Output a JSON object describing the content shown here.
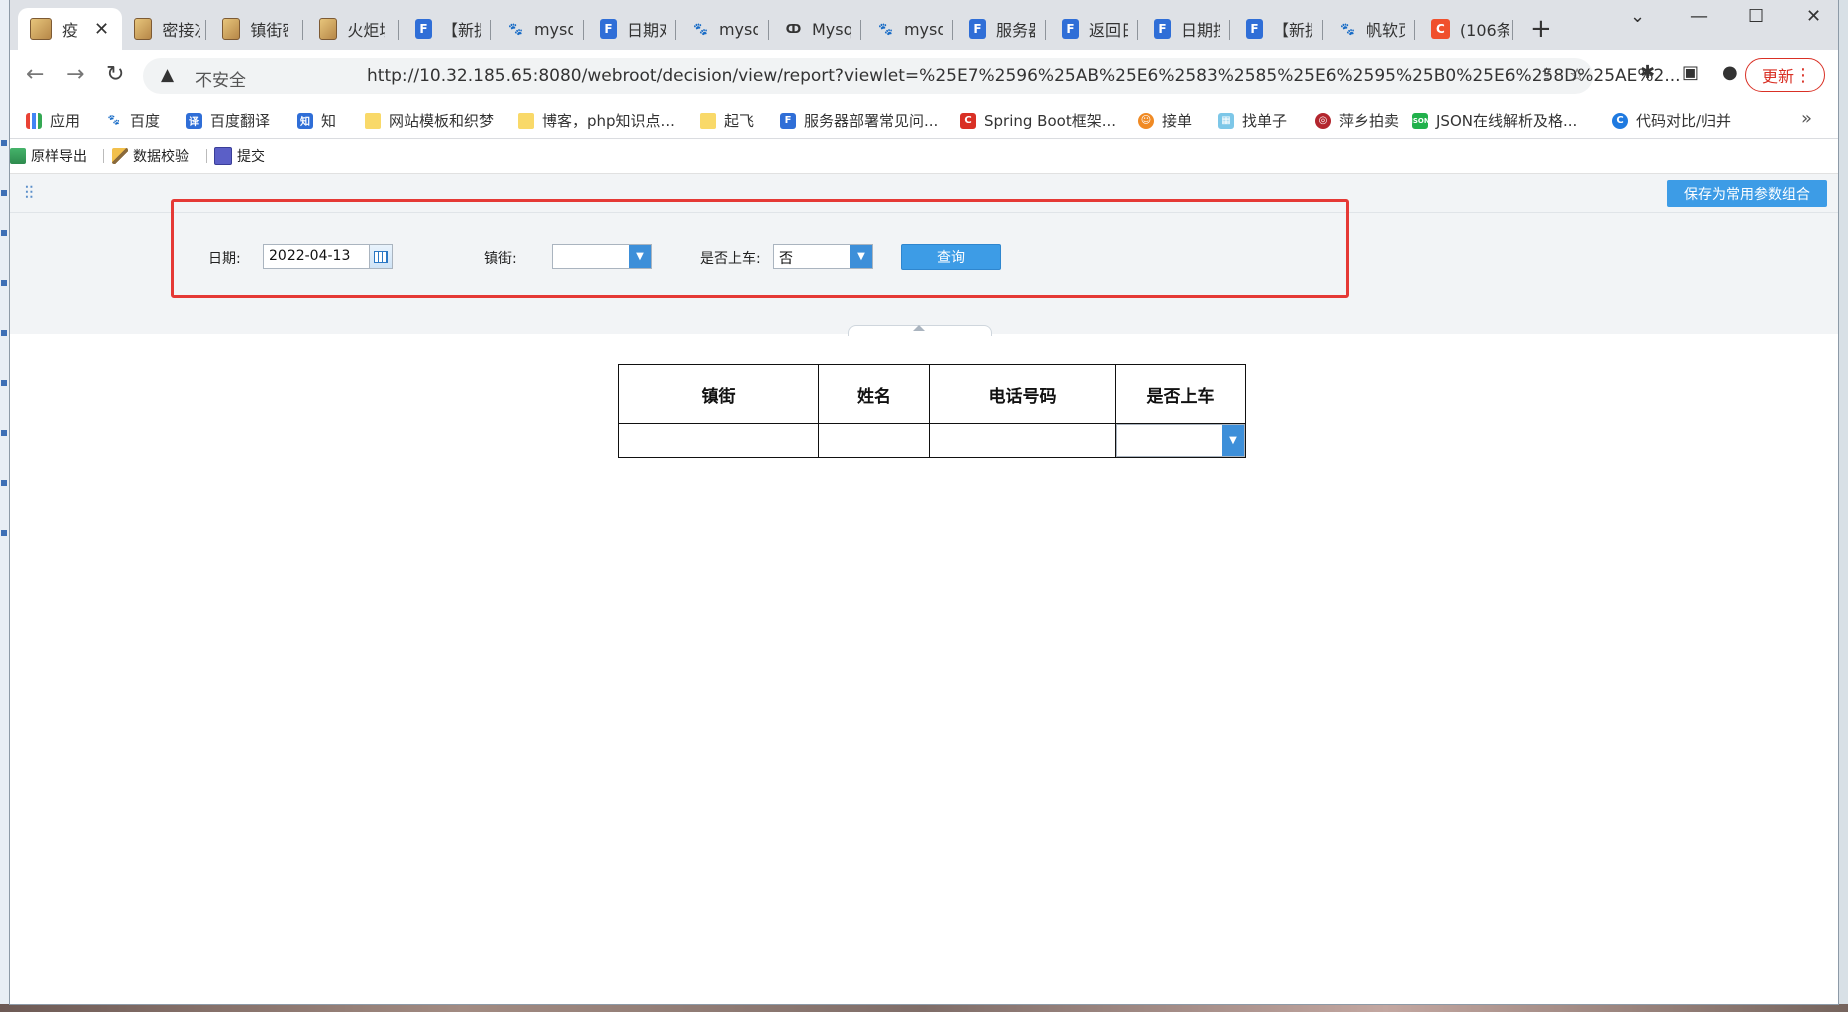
{
  "browser": {
    "tabs": [
      {
        "label": "疫",
        "icon": "image-icon",
        "active": true
      },
      {
        "label": "密接次",
        "icon": "image-icon"
      },
      {
        "label": "镇街密",
        "icon": "image-icon"
      },
      {
        "label": "火炬填",
        "icon": "image-icon"
      },
      {
        "label": "【新提",
        "icon": "fanruan-icon"
      },
      {
        "label": "mysql",
        "icon": "baidu-paw-icon"
      },
      {
        "label": "日期对",
        "icon": "fanruan-icon"
      },
      {
        "label": "mysql",
        "icon": "baidu-paw-icon"
      },
      {
        "label": "Mysql",
        "icon": "cnblogs-icon"
      },
      {
        "label": "mysql",
        "icon": "baidu-paw-icon"
      },
      {
        "label": "服务器",
        "icon": "fanruan-icon"
      },
      {
        "label": "返回日",
        "icon": "fanruan-icon"
      },
      {
        "label": "日期控",
        "icon": "fanruan-icon"
      },
      {
        "label": "【新提",
        "icon": "fanruan-icon"
      },
      {
        "label": "帆软页",
        "icon": "baidu-paw-icon"
      },
      {
        "label": "(106条",
        "icon": "csdn-icon"
      }
    ],
    "address": {
      "security_label": "不安全",
      "url": "http://10.32.185.65:8080/webroot/decision/view/report?viewlet=%25E7%2596%25AB%25E6%2583%2585%25E6%2595%25B0%25E6%258D%25AE%2..."
    },
    "update_label": "更新",
    "bookmarks": [
      {
        "label": "应用",
        "icon": "apps-grid-icon"
      },
      {
        "label": "百度",
        "icon": "baidu-paw-icon"
      },
      {
        "label": "百度翻译",
        "icon": "translate-icon"
      },
      {
        "label": "知",
        "icon": "zhihu-icon"
      },
      {
        "label": "网站模板和织梦",
        "icon": "folder-icon"
      },
      {
        "label": "博客，php知识点...",
        "icon": "folder-icon"
      },
      {
        "label": "起飞",
        "icon": "folder-icon"
      },
      {
        "label": "服务器部署常见问...",
        "icon": "fanruan-icon"
      },
      {
        "label": "Spring Boot框架...",
        "icon": "csdn-icon"
      },
      {
        "label": "接单",
        "icon": "orange-face-icon"
      },
      {
        "label": "找单子",
        "icon": "grid-app-icon"
      },
      {
        "label": "萍乡拍卖",
        "icon": "maroon-circle-icon"
      },
      {
        "label": "JSON在线解析及格...",
        "icon": "json-icon"
      },
      {
        "label": "代码对比/归并",
        "icon": "compare-icon"
      }
    ]
  },
  "toolbar": {
    "export_label": "原样导出",
    "validate_label": "数据校验",
    "submit_label": "提交"
  },
  "params": {
    "save_combo_label": "保存为常用参数组合",
    "date_label": "日期:",
    "date_value": "2022-04-13",
    "street_label": "镇街:",
    "street_value": "",
    "onboard_label": "是否上车:",
    "onboard_value": "否",
    "query_label": "查询"
  },
  "report": {
    "headers": [
      "镇街",
      "姓名",
      "电话号码",
      "是否上车"
    ],
    "rows": [
      {
        "street": "",
        "name": "",
        "phone": "",
        "onboard": ""
      }
    ]
  },
  "colors": {
    "accent_blue": "#3d9ce6",
    "highlight_red": "#e53935",
    "update_red": "#d93025"
  }
}
